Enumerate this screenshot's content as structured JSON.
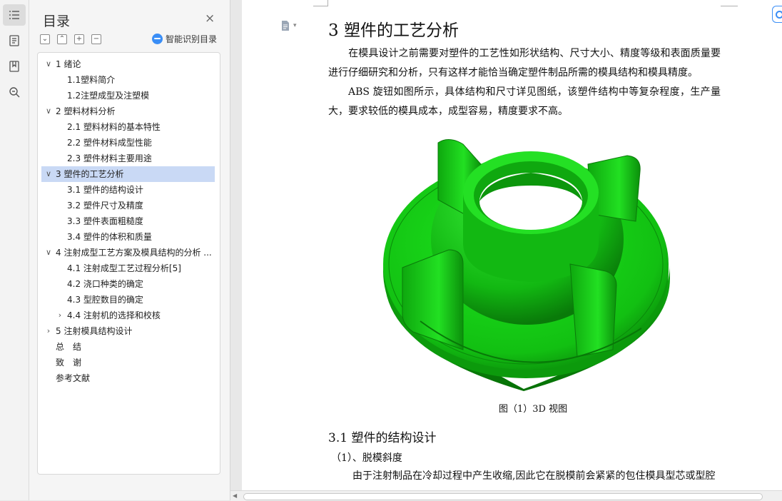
{
  "toc": {
    "title": "目录",
    "close": "×",
    "tools": [
      "⌄",
      "⌃",
      "+",
      "−"
    ],
    "smart_label": "智能识别目录",
    "items": [
      {
        "label": "1 绪论",
        "level": 1,
        "arrow": "∨",
        "selected": false
      },
      {
        "label": "1.1塑料简介",
        "level": 2,
        "arrow": "",
        "selected": false
      },
      {
        "label": "1.2注塑成型及注塑模",
        "level": 2,
        "arrow": "",
        "selected": false
      },
      {
        "label": "2 塑料材料分析",
        "level": 1,
        "arrow": "∨",
        "selected": false
      },
      {
        "label": "2.1 塑料材料的基本特性",
        "level": 2,
        "arrow": "",
        "selected": false
      },
      {
        "label": "2.2 塑件材料成型性能",
        "level": 2,
        "arrow": "",
        "selected": false
      },
      {
        "label": "2.3 塑件材料主要用途",
        "level": 2,
        "arrow": "",
        "selected": false
      },
      {
        "label": "3 塑件的工艺分析",
        "level": 1,
        "arrow": "∨",
        "selected": true
      },
      {
        "label": "3.1 塑件的结构设计",
        "level": 2,
        "arrow": "",
        "selected": false
      },
      {
        "label": "3.2 塑件尺寸及精度",
        "level": 2,
        "arrow": "",
        "selected": false
      },
      {
        "label": "3.3 塑件表面粗糙度",
        "level": 2,
        "arrow": "",
        "selected": false
      },
      {
        "label": "3.4 塑件的体积和质量",
        "level": 2,
        "arrow": "",
        "selected": false
      },
      {
        "label": "4 注射成型工艺方案及模具结构的分析 ...",
        "level": 1,
        "arrow": "∨",
        "selected": false
      },
      {
        "label": "4.1 注射成型工艺过程分析[5]",
        "level": 2,
        "arrow": "",
        "selected": false
      },
      {
        "label": "4.2 浇口种类的确定",
        "level": 2,
        "arrow": "",
        "selected": false
      },
      {
        "label": "4.3 型腔数目的确定",
        "level": 2,
        "arrow": "",
        "selected": false
      },
      {
        "label": "4.4 注射机的选择和校核",
        "level": 2,
        "arrow": "›",
        "selected": false
      },
      {
        "label": "5 注射模具结构设计",
        "level": 1,
        "arrow": "›",
        "selected": false
      },
      {
        "label": "总　结",
        "level": 0,
        "arrow": "",
        "selected": false
      },
      {
        "label": "致　谢",
        "level": 0,
        "arrow": "",
        "selected": false
      },
      {
        "label": "参考文献",
        "level": 0,
        "arrow": "",
        "selected": false
      }
    ]
  },
  "document": {
    "heading": "3 塑件的工艺分析",
    "para1": "在模具设计之前需要对塑件的工艺性如形状结构、尺寸大小、精度等级和表面质量要进行仔细研究和分析，只有这样才能恰当确定塑件制品所需的模具结构和模具精度。",
    "para2": "ABS 旋钮如图所示，具体结构和尺寸详见图纸，该塑件结构中等复杂程度，生产量大，要求较低的模具成本，成型容易，精度要求不高。",
    "caption": "图（1）3D 视图",
    "subheading": "3.1 塑件的结构设计",
    "item1": "（1）、脱模斜度",
    "last_line": "由于注射制品在冷却过程中产生收缩,因此它在脱模前会紧紧的包住模具型芯或型腔"
  },
  "colors": {
    "part_green": "#17d817",
    "selection": "#c9d9f5",
    "accent": "#3a8ef6"
  }
}
